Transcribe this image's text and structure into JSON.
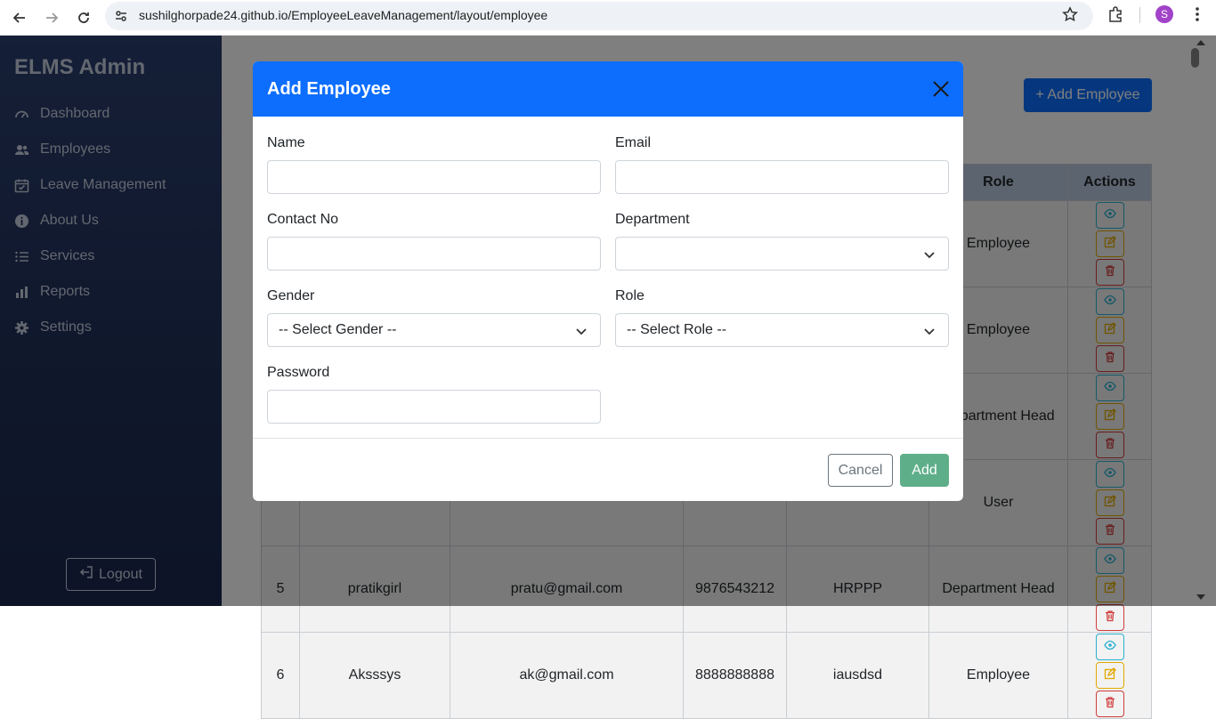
{
  "browser": {
    "url": "sushilghorpade24.github.io/EmployeeLeaveManagement/layout/employee",
    "profile_initial": "S"
  },
  "sidebar": {
    "brand": "ELMS Admin",
    "items": [
      {
        "label": "Dashboard",
        "icon": "dashboard-icon"
      },
      {
        "label": "Employees",
        "icon": "users-icon"
      },
      {
        "label": "Leave Management",
        "icon": "calendar-check-icon"
      },
      {
        "label": "About Us",
        "icon": "info-icon"
      },
      {
        "label": "Services",
        "icon": "list-icon"
      },
      {
        "label": "Reports",
        "icon": "bar-chart-icon"
      },
      {
        "label": "Settings",
        "icon": "gear-icon"
      }
    ],
    "logout_label": "Logout"
  },
  "main": {
    "add_employee_label": "+ Add Employee",
    "table": {
      "headers": [
        "",
        "",
        "",
        "",
        "",
        "Role",
        "Actions"
      ],
      "rows": [
        {
          "id": "",
          "name": "",
          "email": "",
          "contact": "",
          "dept": "",
          "role": "Employee"
        },
        {
          "id": "",
          "name": "",
          "email": "",
          "contact": "",
          "dept": "",
          "role": "Employee"
        },
        {
          "id": "",
          "name": "",
          "email": "",
          "contact": "",
          "dept": "",
          "role": "Department Head"
        },
        {
          "id": "",
          "name": "",
          "email": "",
          "contact": "",
          "dept": "",
          "role": "User"
        },
        {
          "id": "5",
          "name": "pratikgirl",
          "email": "pratu@gmail.com",
          "contact": "9876543212",
          "dept": "HRPPP",
          "role": "Department Head"
        },
        {
          "id": "6",
          "name": "Aksssys",
          "email": "ak@gmail.com",
          "contact": "8888888888",
          "dept": "iausdsd",
          "role": "Employee"
        }
      ]
    }
  },
  "modal": {
    "title": "Add Employee",
    "fields": {
      "name": {
        "label": "Name",
        "value": ""
      },
      "email": {
        "label": "Email",
        "value": ""
      },
      "contact": {
        "label": "Contact No",
        "value": ""
      },
      "department": {
        "label": "Department",
        "value": ""
      },
      "gender": {
        "label": "Gender",
        "value": "-- Select Gender --"
      },
      "role": {
        "label": "Role",
        "value": "-- Select Role --"
      },
      "password": {
        "label": "Password",
        "value": ""
      }
    },
    "cancel_label": "Cancel",
    "add_label": "Add"
  },
  "colors": {
    "primary": "#0d6efd",
    "sidebar": "#1f2f57",
    "add_disabled": "#5fae8a"
  }
}
